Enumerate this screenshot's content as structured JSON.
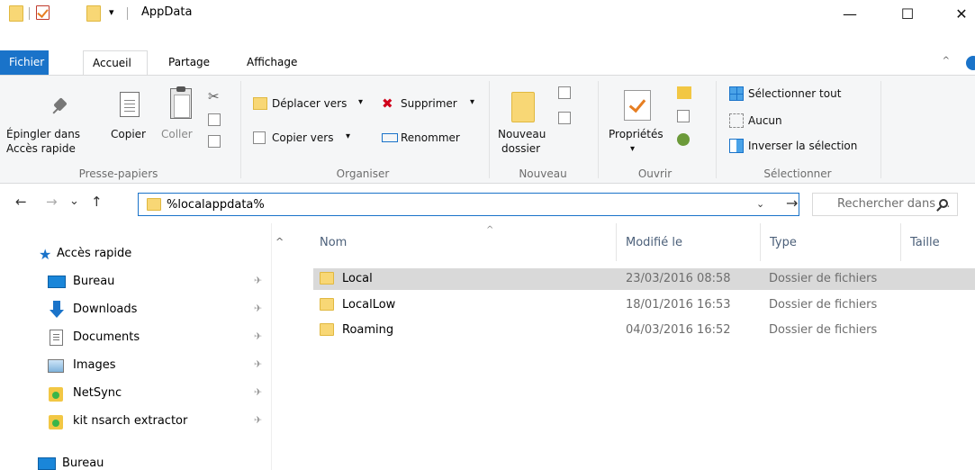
{
  "window": {
    "title": "AppData",
    "minimize_glyph": "—",
    "maximize_glyph": "☐",
    "close_glyph": "✕",
    "quick_access_dropdown_glyph": "▾"
  },
  "ribbon_tabs": {
    "file": "Fichier",
    "home": "Accueil",
    "share": "Partage",
    "view": "Affichage"
  },
  "ribbon": {
    "clipboard": {
      "pin_line1": "Épingler dans",
      "pin_line2": "Accès rapide",
      "copy": "Copier",
      "paste": "Coller",
      "group_label": "Presse-papiers"
    },
    "organize": {
      "move_to": "Déplacer vers",
      "copy_to": "Copier vers",
      "delete": "Supprimer",
      "rename": "Renommer",
      "group_label": "Organiser",
      "dropdown_glyph": "▾"
    },
    "new": {
      "new_folder_line1": "Nouveau",
      "new_folder_line2": "dossier",
      "group_label": "Nouveau"
    },
    "open": {
      "properties": "Propriétés",
      "group_label": "Ouvrir"
    },
    "select": {
      "select_all": "Sélectionner tout",
      "select_none": "Aucun",
      "invert": "Inverser la sélection",
      "group_label": "Sélectionner"
    }
  },
  "address_bar": {
    "back_glyph": "←",
    "forward_glyph": "→",
    "recent_glyph": "⌄",
    "up_glyph": "↑",
    "path": "%localappdata%",
    "dropdown_glyph": "⌄",
    "go_glyph": "→"
  },
  "search": {
    "placeholder": "Rechercher dans ..."
  },
  "nav_pane": {
    "quick_access": "Accès rapide",
    "items": [
      {
        "label": "Bureau",
        "icon": "desktop-icon"
      },
      {
        "label": "Downloads",
        "icon": "download-icon"
      },
      {
        "label": "Documents",
        "icon": "documents-icon"
      },
      {
        "label": "Images",
        "icon": "pictures-icon"
      },
      {
        "label": "NetSync",
        "icon": "sync-folder-icon"
      },
      {
        "label": "kit nsarch extractor",
        "icon": "sync-folder-icon"
      }
    ],
    "desktop_root": "Bureau",
    "pin_glyph": "✈",
    "scroll_up_glyph": "^"
  },
  "file_list": {
    "sort_glyph": "^",
    "columns": {
      "name": "Nom",
      "modified": "Modifié le",
      "type": "Type",
      "size": "Taille"
    },
    "rows": [
      {
        "name": "Local",
        "modified": "23/03/2016 08:58",
        "type": "Dossier de fichiers",
        "selected": true
      },
      {
        "name": "LocalLow",
        "modified": "18/01/2016 16:53",
        "type": "Dossier de fichiers",
        "selected": false
      },
      {
        "name": "Roaming",
        "modified": "04/03/2016 16:52",
        "type": "Dossier de fichiers",
        "selected": false
      }
    ]
  },
  "colors": {
    "accent": "#1a73c9",
    "folder": "#f8d775",
    "selection": "#d9d9d9",
    "delete_red": "#d0021b"
  }
}
